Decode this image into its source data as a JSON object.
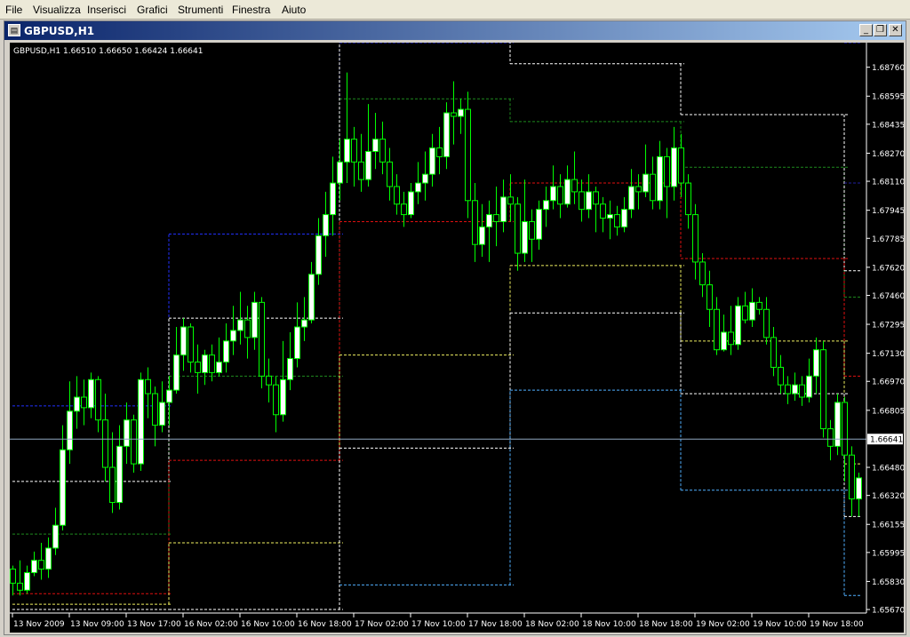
{
  "menu": [
    "File",
    "Visualizza",
    "Inserisci",
    "Grafici",
    "Strumenti",
    "Finestra",
    "Aiuto"
  ],
  "window": {
    "title": "GBPUSD,H1",
    "minimize": "_",
    "restore": "❐",
    "close": "✕"
  },
  "chart_info": "GBPUSD,H1  1.66510 1.66650 1.66424 1.66641",
  "colors": {
    "background": "#000000",
    "axis": "#ffffff",
    "bull_body": "#ffffff",
    "bear_body": "#000000",
    "wick": "#00ff00",
    "bid_line": "#8fa6c0",
    "price_label_bg": "#ffffff",
    "blue": "#2230ff",
    "green": "#1e8a1e",
    "red": "#e01010",
    "yellow": "#f0f060",
    "white": "#ffffff",
    "cyan": "#50b0ff",
    "navy": "#2020a0"
  },
  "chart_data": {
    "type": "candlestick",
    "symbol": "GBPUSD",
    "timeframe": "H1",
    "ylim": [
      1.6565,
      1.689
    ],
    "yticks": [
      "1.68760",
      "1.68595",
      "1.68435",
      "1.68270",
      "1.68110",
      "1.67945",
      "1.67785",
      "1.67620",
      "1.67460",
      "1.67295",
      "1.67130",
      "1.66970",
      "1.66805",
      "1.66641",
      "1.66480",
      "1.66320",
      "1.66155",
      "1.65995",
      "1.65830",
      "1.65670"
    ],
    "yticks_values": [
      1.6876,
      1.68595,
      1.68435,
      1.6827,
      1.6811,
      1.67945,
      1.67785,
      1.6762,
      1.6746,
      1.67295,
      1.6713,
      1.6697,
      1.66805,
      1.66641,
      1.6648,
      1.6632,
      1.66155,
      1.65995,
      1.6583,
      1.6567
    ],
    "xticks": [
      "13 Nov 2009",
      "13 Nov 09:00",
      "13 Nov 17:00",
      "16 Nov 02:00",
      "16 Nov 10:00",
      "16 Nov 18:00",
      "17 Nov 02:00",
      "17 Nov 10:00",
      "17 Nov 18:00",
      "18 Nov 02:00",
      "18 Nov 10:00",
      "18 Nov 18:00",
      "19 Nov 02:00",
      "19 Nov 10:00",
      "19 Nov 18:00"
    ],
    "xticks_bar_index": [
      0,
      8,
      16,
      24,
      32,
      40,
      48,
      56,
      64,
      72,
      80,
      88,
      96,
      104,
      112
    ],
    "current_price": 1.66641,
    "current_price_label": "1.66641",
    "day_boundaries": [
      22,
      46,
      70,
      94,
      117
    ],
    "candles": [
      [
        1.659,
        1.6582,
        1.6592,
        1.6575
      ],
      [
        1.6582,
        1.6578,
        1.6595,
        1.6575
      ],
      [
        1.6578,
        1.6588,
        1.6592,
        1.6576
      ],
      [
        1.6588,
        1.6595,
        1.66,
        1.6586
      ],
      [
        1.6595,
        1.659,
        1.6605,
        1.6584
      ],
      [
        1.659,
        1.6602,
        1.6608,
        1.6585
      ],
      [
        1.6602,
        1.6615,
        1.6625,
        1.6598
      ],
      [
        1.6615,
        1.6658,
        1.6672,
        1.6612
      ],
      [
        1.6658,
        1.668,
        1.6697,
        1.665
      ],
      [
        1.668,
        1.6688,
        1.67,
        1.667
      ],
      [
        1.6688,
        1.6682,
        1.6698,
        1.6672
      ],
      [
        1.6682,
        1.6698,
        1.6702,
        1.6676
      ],
      [
        1.6698,
        1.6675,
        1.67,
        1.6668
      ],
      [
        1.6675,
        1.6648,
        1.669,
        1.664
      ],
      [
        1.6648,
        1.6628,
        1.6668,
        1.6622
      ],
      [
        1.6628,
        1.666,
        1.6672,
        1.6624
      ],
      [
        1.666,
        1.6675,
        1.6685,
        1.665
      ],
      [
        1.6675,
        1.665,
        1.6678,
        1.6645
      ],
      [
        1.665,
        1.6698,
        1.6702,
        1.6646
      ],
      [
        1.6698,
        1.669,
        1.6705,
        1.6676
      ],
      [
        1.669,
        1.6672,
        1.6694,
        1.666
      ],
      [
        1.6672,
        1.6685,
        1.6697,
        1.6668
      ],
      [
        1.6685,
        1.6692,
        1.67,
        1.6672
      ],
      [
        1.6692,
        1.6712,
        1.6728,
        1.669
      ],
      [
        1.6712,
        1.6728,
        1.6733,
        1.6703
      ],
      [
        1.6728,
        1.6708,
        1.673,
        1.6702
      ],
      [
        1.6708,
        1.6702,
        1.6718,
        1.669
      ],
      [
        1.6702,
        1.6712,
        1.6715,
        1.6695
      ],
      [
        1.6712,
        1.6702,
        1.6718,
        1.6697
      ],
      [
        1.6702,
        1.6708,
        1.6722,
        1.67
      ],
      [
        1.6708,
        1.672,
        1.673,
        1.6702
      ],
      [
        1.672,
        1.6726,
        1.674,
        1.6712
      ],
      [
        1.6726,
        1.6732,
        1.6748,
        1.6718
      ],
      [
        1.6732,
        1.6722,
        1.674,
        1.671
      ],
      [
        1.6722,
        1.6742,
        1.6748,
        1.6715
      ],
      [
        1.6742,
        1.67,
        1.6745,
        1.6693
      ],
      [
        1.67,
        1.6695,
        1.671,
        1.6685
      ],
      [
        1.6695,
        1.6678,
        1.67,
        1.6668
      ],
      [
        1.6678,
        1.6698,
        1.672,
        1.6674
      ],
      [
        1.6698,
        1.671,
        1.6725,
        1.6692
      ],
      [
        1.671,
        1.6728,
        1.6742,
        1.6705
      ],
      [
        1.6728,
        1.6732,
        1.6745,
        1.672
      ],
      [
        1.6732,
        1.6758,
        1.6765,
        1.673
      ],
      [
        1.6758,
        1.678,
        1.679,
        1.6752
      ],
      [
        1.678,
        1.6792,
        1.6805,
        1.6768
      ],
      [
        1.6792,
        1.681,
        1.6825,
        1.678
      ],
      [
        1.681,
        1.6822,
        1.6835,
        1.68
      ],
      [
        1.6822,
        1.6835,
        1.6873,
        1.681
      ],
      [
        1.6835,
        1.6822,
        1.6842,
        1.6808
      ],
      [
        1.6822,
        1.6812,
        1.6838,
        1.6805
      ],
      [
        1.6812,
        1.6828,
        1.6855,
        1.6808
      ],
      [
        1.6828,
        1.6835,
        1.685,
        1.6818
      ],
      [
        1.6835,
        1.6822,
        1.6845,
        1.6815
      ],
      [
        1.6822,
        1.6808,
        1.683,
        1.68
      ],
      [
        1.6808,
        1.6798,
        1.6815,
        1.6792
      ],
      [
        1.6798,
        1.6792,
        1.6805,
        1.6785
      ],
      [
        1.6792,
        1.6805,
        1.681,
        1.679
      ],
      [
        1.6805,
        1.681,
        1.6822,
        1.6798
      ],
      [
        1.681,
        1.6815,
        1.6828,
        1.68
      ],
      [
        1.6815,
        1.683,
        1.6838,
        1.6808
      ],
      [
        1.683,
        1.6825,
        1.6842,
        1.6815
      ],
      [
        1.6825,
        1.685,
        1.6856,
        1.6818
      ],
      [
        1.685,
        1.6848,
        1.6868,
        1.6832
      ],
      [
        1.6848,
        1.6852,
        1.6858,
        1.6838
      ],
      [
        1.6852,
        1.68,
        1.6862,
        1.679
      ],
      [
        1.68,
        1.6775,
        1.681,
        1.6765
      ],
      [
        1.6775,
        1.6785,
        1.6798,
        1.6768
      ],
      [
        1.6785,
        1.6792,
        1.68,
        1.6765
      ],
      [
        1.6792,
        1.6788,
        1.6808,
        1.6774
      ],
      [
        1.6788,
        1.6802,
        1.6812,
        1.6782
      ],
      [
        1.6802,
        1.6798,
        1.6815,
        1.6788
      ],
      [
        1.6798,
        1.677,
        1.6802,
        1.676
      ],
      [
        1.677,
        1.6788,
        1.6812,
        1.6765
      ],
      [
        1.6788,
        1.6778,
        1.6795,
        1.6765
      ],
      [
        1.6778,
        1.6795,
        1.68,
        1.6772
      ],
      [
        1.6795,
        1.68,
        1.6808,
        1.6785
      ],
      [
        1.68,
        1.6808,
        1.682,
        1.6795
      ],
      [
        1.6808,
        1.6798,
        1.6815,
        1.679
      ],
      [
        1.6798,
        1.6812,
        1.682,
        1.6796
      ],
      [
        1.6812,
        1.6805,
        1.6828,
        1.6798
      ],
      [
        1.6805,
        1.6795,
        1.6812,
        1.6788
      ],
      [
        1.6795,
        1.6805,
        1.6815,
        1.679
      ],
      [
        1.6805,
        1.6798,
        1.6808,
        1.6782
      ],
      [
        1.6798,
        1.679,
        1.6802,
        1.6782
      ],
      [
        1.679,
        1.6792,
        1.68,
        1.6778
      ],
      [
        1.6792,
        1.6785,
        1.6797,
        1.678
      ],
      [
        1.6785,
        1.6795,
        1.6802,
        1.6782
      ],
      [
        1.6795,
        1.6808,
        1.6818,
        1.679
      ],
      [
        1.6808,
        1.6805,
        1.6815,
        1.6795
      ],
      [
        1.6805,
        1.6815,
        1.6832,
        1.6802
      ],
      [
        1.6815,
        1.68,
        1.6825,
        1.6795
      ],
      [
        1.68,
        1.6825,
        1.6834,
        1.6795
      ],
      [
        1.6825,
        1.6808,
        1.683,
        1.679
      ],
      [
        1.6808,
        1.683,
        1.6842,
        1.68
      ],
      [
        1.683,
        1.681,
        1.6838,
        1.6802
      ],
      [
        1.681,
        1.6792,
        1.6815,
        1.6784
      ],
      [
        1.6792,
        1.6765,
        1.6798,
        1.6755
      ],
      [
        1.6765,
        1.6752,
        1.677,
        1.6745
      ],
      [
        1.6752,
        1.6738,
        1.676,
        1.6728
      ],
      [
        1.6738,
        1.6715,
        1.6745,
        1.6712
      ],
      [
        1.6715,
        1.6725,
        1.6735,
        1.6714
      ],
      [
        1.6725,
        1.6718,
        1.674,
        1.6712
      ],
      [
        1.6718,
        1.674,
        1.6745,
        1.6715
      ],
      [
        1.674,
        1.6732,
        1.6748,
        1.673
      ],
      [
        1.6732,
        1.6742,
        1.675,
        1.6728
      ],
      [
        1.6742,
        1.6738,
        1.6745,
        1.6735
      ],
      [
        1.6738,
        1.6722,
        1.6745,
        1.6718
      ],
      [
        1.6722,
        1.6705,
        1.6728,
        1.67
      ],
      [
        1.6705,
        1.6695,
        1.6712,
        1.669
      ],
      [
        1.6695,
        1.669,
        1.67,
        1.6684
      ],
      [
        1.669,
        1.6695,
        1.6702,
        1.6686
      ],
      [
        1.6695,
        1.6688,
        1.67,
        1.6683
      ],
      [
        1.6688,
        1.67,
        1.671,
        1.6685
      ],
      [
        1.67,
        1.6715,
        1.6722,
        1.669
      ],
      [
        1.6715,
        1.667,
        1.672,
        1.6665
      ],
      [
        1.667,
        1.666,
        1.6675,
        1.6652
      ],
      [
        1.666,
        1.6685,
        1.669,
        1.6655
      ],
      [
        1.6685,
        1.6655,
        1.6688,
        1.664
      ],
      [
        1.6655,
        1.663,
        1.666,
        1.662
      ],
      [
        1.663,
        1.6642,
        1.6645,
        1.662
      ],
      [
        1.6642,
        1.6635,
        1.665,
        1.6625
      ],
      [
        1.6635,
        1.6615,
        1.664,
        1.6605
      ],
      [
        1.6615,
        1.6622,
        1.663,
        1.661
      ],
      [
        1.6622,
        1.664,
        1.6648,
        1.6615
      ],
      [
        1.664,
        1.6655,
        1.6658,
        1.6618
      ],
      [
        1.6655,
        1.664,
        1.666,
        1.662
      ],
      [
        1.664,
        1.6645,
        1.6652,
        1.663
      ],
      [
        1.6645,
        1.665,
        1.6652,
        1.6635
      ],
      [
        1.665,
        1.6658,
        1.6665,
        1.664
      ],
      [
        1.6658,
        1.6648,
        1.6668,
        1.6642
      ],
      [
        1.6648,
        1.6665,
        1.667,
        1.6645
      ],
      [
        1.6665,
        1.6651,
        1.6668,
        1.6642
      ],
      [
        1.6651,
        1.6664,
        1.6665,
        1.6642
      ]
    ],
    "levels": [
      {
        "color": "blue",
        "segments": [
          [
            0,
            22,
            1.6683
          ],
          [
            22,
            46,
            1.6781
          ],
          [
            46,
            70,
            1.689
          ],
          [
            117,
            119,
            1.689
          ]
        ]
      },
      {
        "color": "green",
        "segments": [
          [
            0,
            22,
            1.661
          ],
          [
            22,
            46,
            1.67
          ],
          [
            46,
            70,
            1.6858
          ],
          [
            70,
            94,
            1.6845
          ],
          [
            94,
            117,
            1.6819
          ],
          [
            117,
            119,
            1.6745
          ]
        ]
      },
      {
        "color": "white",
        "segments": [
          [
            0,
            22,
            1.664
          ],
          [
            22,
            46,
            1.6733
          ],
          [
            46,
            70,
            1.6891
          ],
          [
            70,
            94,
            1.6878
          ],
          [
            94,
            117,
            1.6849
          ],
          [
            117,
            119,
            1.676
          ]
        ]
      },
      {
        "color": "red",
        "segments": [
          [
            0,
            22,
            1.6576
          ],
          [
            22,
            46,
            1.6652
          ],
          [
            46,
            70,
            1.6788
          ],
          [
            70,
            94,
            1.681
          ],
          [
            94,
            117,
            1.6767
          ],
          [
            117,
            119,
            1.67
          ]
        ]
      },
      {
        "color": "yellow",
        "segments": [
          [
            0,
            22,
            1.657
          ],
          [
            22,
            46,
            1.6605
          ],
          [
            46,
            70,
            1.6712
          ],
          [
            70,
            94,
            1.6763
          ],
          [
            94,
            117,
            1.672
          ],
          [
            117,
            119,
            1.665
          ]
        ]
      },
      {
        "color": "white",
        "segments": [
          [
            0,
            22,
            1.6567
          ],
          [
            22,
            46,
            1.6567
          ],
          [
            46,
            70,
            1.6659
          ],
          [
            70,
            94,
            1.6736
          ],
          [
            94,
            117,
            1.669
          ],
          [
            117,
            119,
            1.662
          ]
        ]
      },
      {
        "color": "cyan",
        "segments": [
          [
            46,
            70,
            1.6581
          ],
          [
            70,
            94,
            1.6692
          ],
          [
            94,
            117,
            1.6635
          ],
          [
            117,
            119,
            1.6575
          ]
        ]
      },
      {
        "color": "navy",
        "segments": [
          [
            117,
            119,
            1.681
          ]
        ]
      }
    ]
  }
}
